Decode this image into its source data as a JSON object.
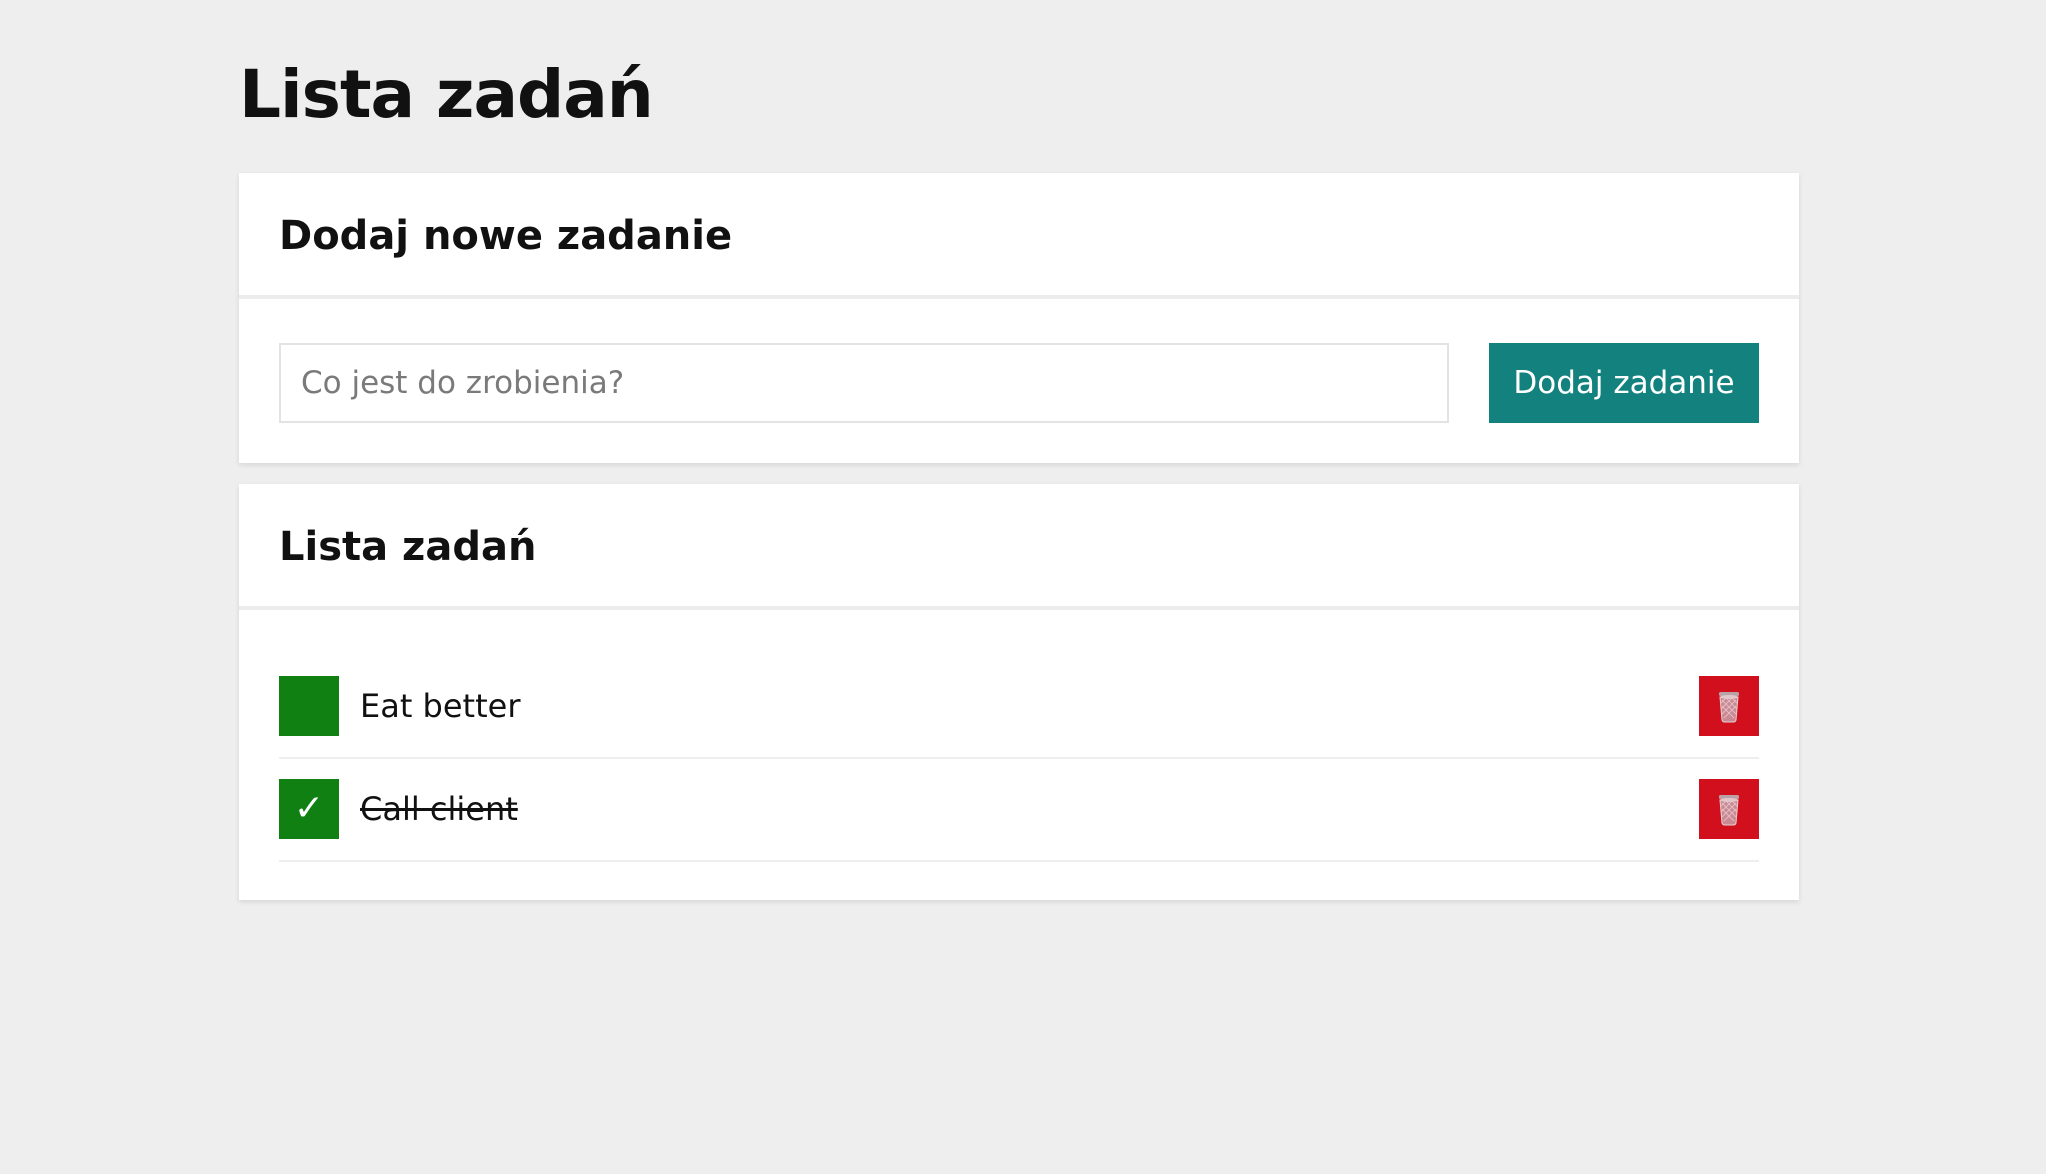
{
  "page": {
    "title": "Lista zadań"
  },
  "add_card": {
    "title": "Dodaj nowe zadanie",
    "input": {
      "placeholder": "Co jest do zrobienia?",
      "value": ""
    },
    "add_button_label": "Dodaj zadanie"
  },
  "list_card": {
    "title": "Lista zadań",
    "tasks": [
      {
        "label": "Eat better",
        "completed": false,
        "check_mark": ""
      },
      {
        "label": "Call client",
        "completed": true,
        "check_mark": "✓"
      }
    ]
  },
  "icons": {
    "checkbox": "checkbox-icon",
    "delete": "trash-icon"
  },
  "colors": {
    "background": "#eeeeee",
    "accent": "#13827f",
    "checkbox": "#108012",
    "delete": "#d20f1d"
  }
}
